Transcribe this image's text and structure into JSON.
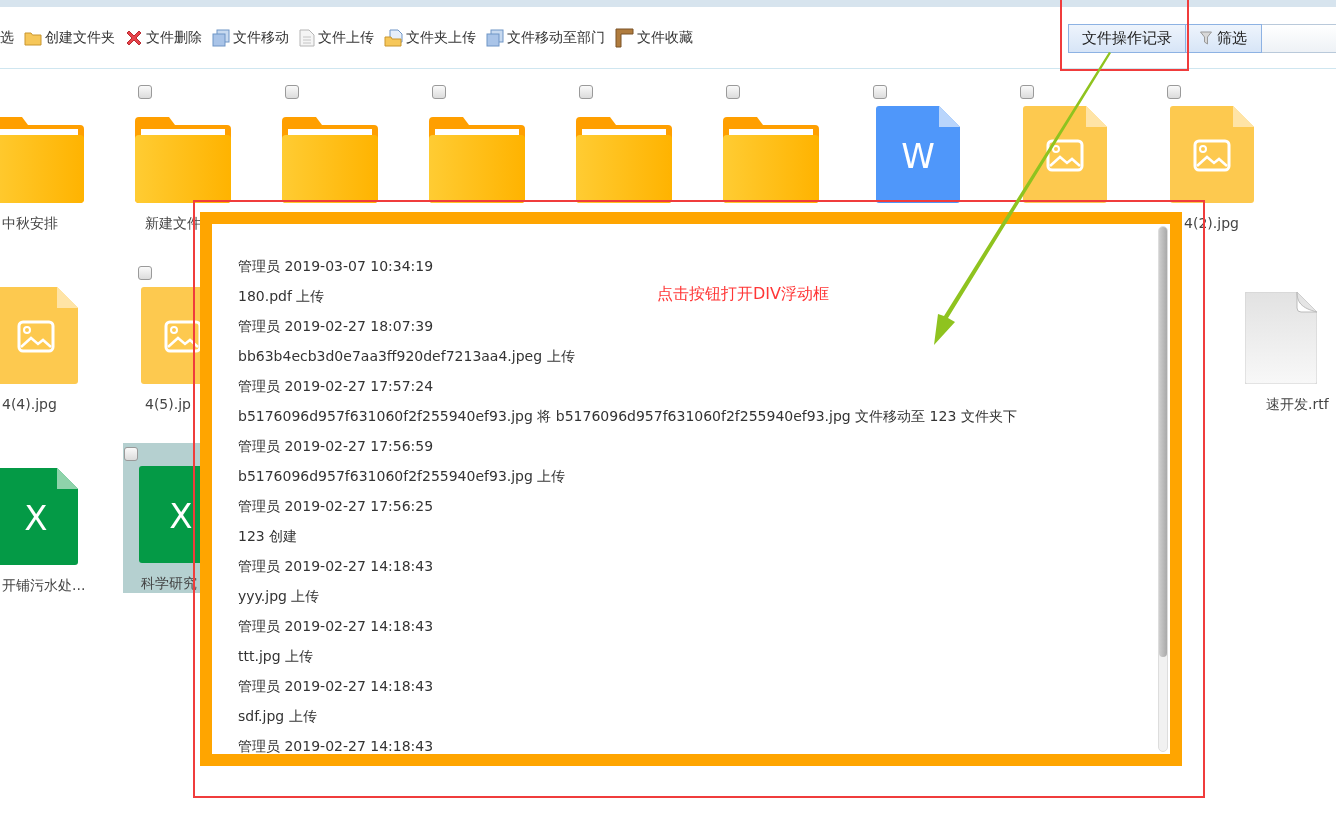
{
  "toolbar": {
    "items": [
      {
        "kind": "plain",
        "label": "选"
      },
      {
        "kind": "create",
        "label": "创建文件夹"
      },
      {
        "kind": "delete",
        "label": "文件删除"
      },
      {
        "kind": "move",
        "label": "文件移动"
      },
      {
        "kind": "upload",
        "label": "文件上传"
      },
      {
        "kind": "folderupload",
        "label": "文件夹上传"
      },
      {
        "kind": "move",
        "label": "文件移动至部门"
      },
      {
        "kind": "favorite",
        "label": "文件收藏"
      }
    ],
    "log_button": {
      "label": "文件操作记录"
    },
    "filter_button": {
      "label": "筛选"
    }
  },
  "files": [
    {
      "left": [
        {
          "kind": "folder",
          "label": "中秋安排",
          "selected": false
        },
        {
          "kind": "folder",
          "label": "新建文件",
          "checked": false,
          "selected": false
        },
        {
          "kind": "folder",
          "checked": false,
          "selected": false
        },
        {
          "kind": "folder",
          "checked": false,
          "selected": false
        },
        {
          "kind": "folder",
          "checked": false,
          "selected": false
        },
        {
          "kind": "folder",
          "checked": false,
          "selected": false
        },
        {
          "kind": "word",
          "badge": "W",
          "checked": false,
          "selected": false
        },
        {
          "kind": "image",
          "checked": false,
          "selected": false
        },
        {
          "kind": "image",
          "label": "4(2).jpg",
          "checked": false,
          "selected": false
        }
      ]
    },
    {
      "left": [
        {
          "kind": "image",
          "label": "4(4).jpg",
          "selected": false
        },
        {
          "kind": "image",
          "label": "4(5).jp",
          "checked": false,
          "selected": false
        }
      ],
      "right": [
        {
          "kind": "blank",
          "label": "速开发.rtf",
          "selected": false
        }
      ]
    },
    {
      "left": [
        {
          "kind": "excel",
          "badge": "X",
          "label": "开铺污水处...",
          "selected": false
        },
        {
          "kind": "excel",
          "badge": "X",
          "label": "科学研究",
          "checked": false,
          "selected": true
        }
      ]
    }
  ],
  "log_popup": {
    "note": "点击按钮打开DIV浮动框",
    "entries": [
      {
        "header": "管理员 2019-03-07 10:34:19",
        "action": "180.pdf 上传"
      },
      {
        "header": "管理员 2019-02-27 18:07:39",
        "action": "bb63b4ecb3d0e7aa3ff920def7213aa4.jpeg 上传"
      },
      {
        "header": "管理员 2019-02-27 17:57:24",
        "action": "b5176096d957f631060f2f255940ef93.jpg 将 b5176096d957f631060f2f255940ef93.jpg 文件移动至 123 文件夹下"
      },
      {
        "header": "管理员 2019-02-27 17:56:59",
        "action": "b5176096d957f631060f2f255940ef93.jpg 上传"
      },
      {
        "header": "管理员 2019-02-27 17:56:25",
        "action": "123 创建"
      },
      {
        "header": "管理员 2019-02-27 14:18:43",
        "action": "yyy.jpg 上传"
      },
      {
        "header": "管理员 2019-02-27 14:18:43",
        "action": "ttt.jpg 上传"
      },
      {
        "header": "管理员 2019-02-27 14:18:43",
        "action": "sdf.jpg 上传"
      },
      {
        "header": "管理员 2019-02-27 14:18:43"
      }
    ]
  }
}
